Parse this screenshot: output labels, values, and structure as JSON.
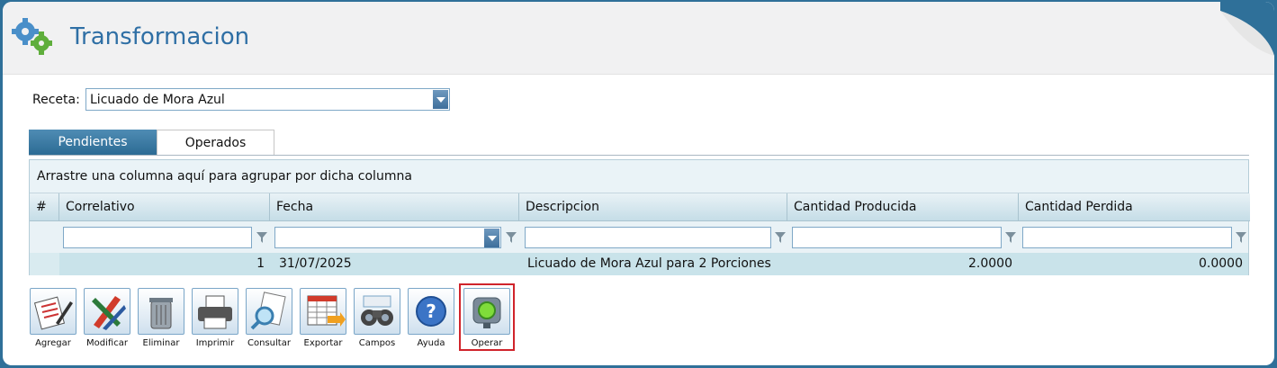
{
  "page": {
    "title": "Transformacion"
  },
  "receta": {
    "label": "Receta:",
    "selected": "Licuado de Mora Azul"
  },
  "tabs": [
    {
      "label": "Pendientes"
    },
    {
      "label": "Operados"
    }
  ],
  "grid": {
    "group_hint": "Arrastre una columna aquí para agrupar por dicha columna",
    "columns": [
      "#",
      "Correlativo",
      "Fecha",
      "Descripcion",
      "Cantidad Producida",
      "Cantidad Perdida"
    ],
    "rows": [
      {
        "correlativo": "1",
        "fecha": "31/07/2025",
        "descripcion": "Licuado de Mora Azul para 2 Porciones",
        "producida": "2.0000",
        "perdida": "0.0000"
      }
    ]
  },
  "toolbar": [
    {
      "label": "Agregar",
      "icon": "add-document-icon"
    },
    {
      "label": "Modificar",
      "icon": "edit-tools-icon"
    },
    {
      "label": "Eliminar",
      "icon": "trash-icon"
    },
    {
      "label": "Imprimir",
      "icon": "printer-icon"
    },
    {
      "label": "Consultar",
      "icon": "search-document-icon"
    },
    {
      "label": "Exportar",
      "icon": "export-spreadsheet-icon"
    },
    {
      "label": "Campos",
      "icon": "binoculars-icon"
    },
    {
      "label": "Ayuda",
      "icon": "help-icon"
    },
    {
      "label": "Operar",
      "icon": "traffic-light-icon"
    }
  ],
  "colors": {
    "accent": "#2f6fa5",
    "highlight": "#d0242b",
    "row": "#c9e3ea"
  }
}
